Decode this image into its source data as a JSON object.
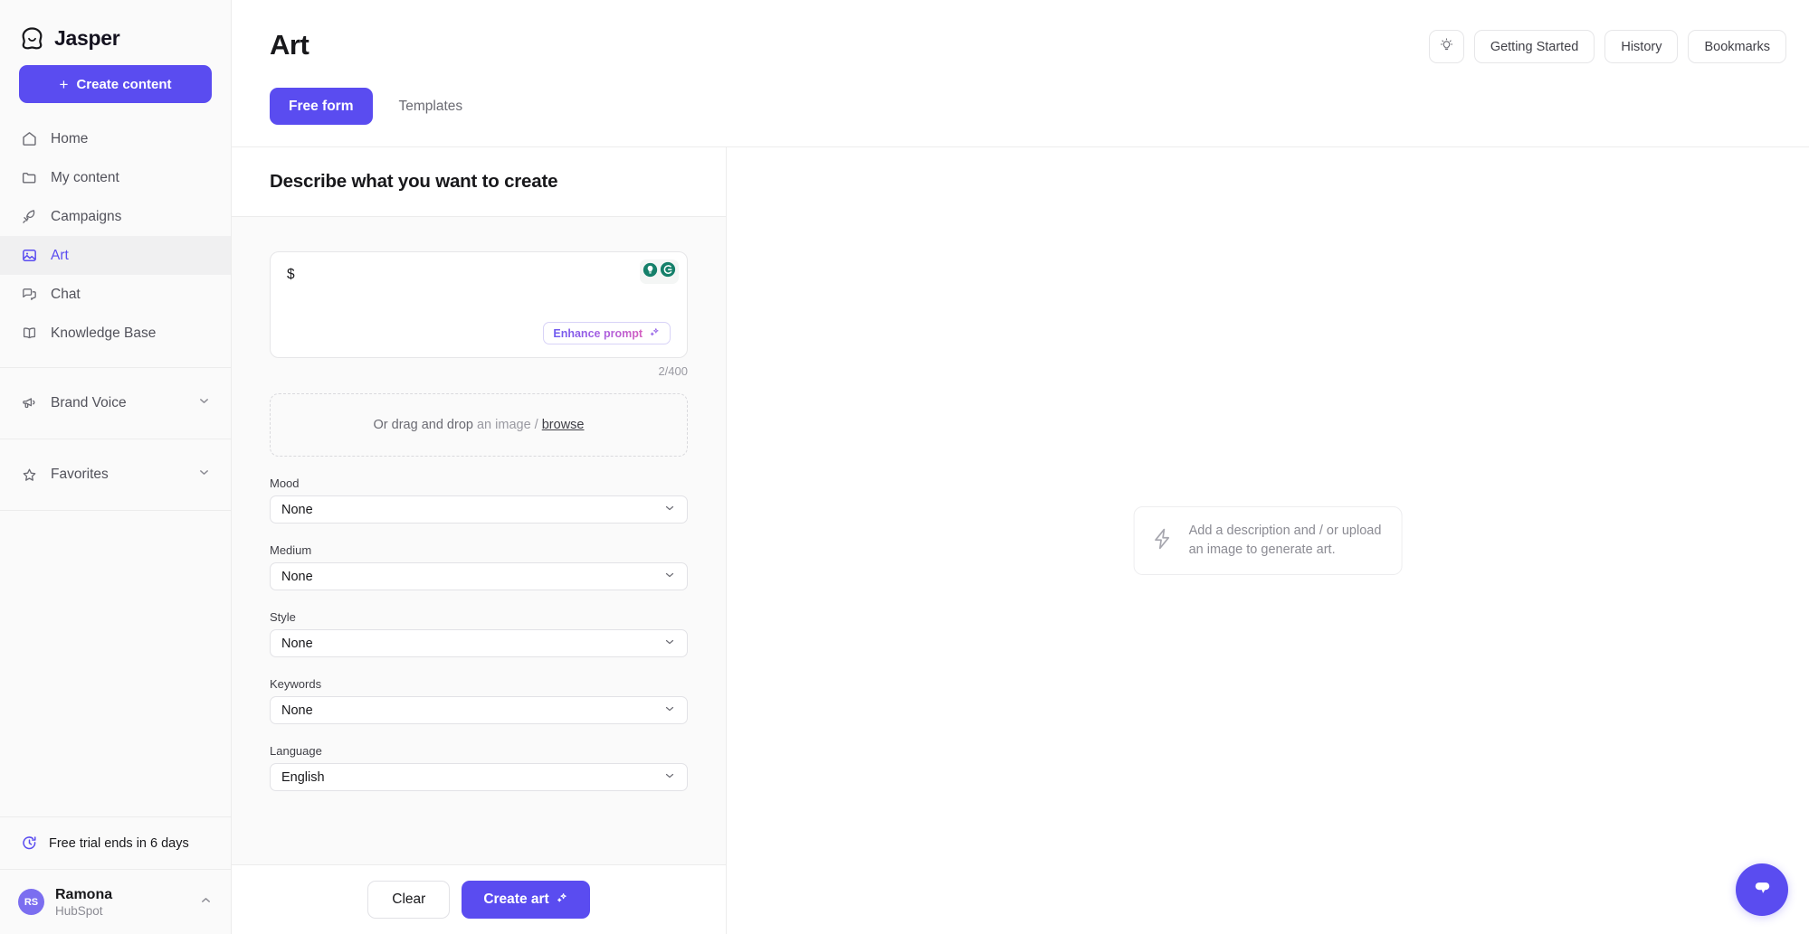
{
  "sidebar": {
    "brand": "Jasper",
    "create_button": "Create content",
    "nav_items": [
      {
        "label": "Home",
        "icon": "home-icon"
      },
      {
        "label": "My content",
        "icon": "folder-icon"
      },
      {
        "label": "Campaigns",
        "icon": "rocket-icon"
      },
      {
        "label": "Art",
        "icon": "image-icon"
      },
      {
        "label": "Chat",
        "icon": "chat-icon"
      },
      {
        "label": "Knowledge Base",
        "icon": "book-icon"
      }
    ],
    "active_nav": "Art",
    "sections": [
      {
        "label": "Brand Voice",
        "icon": "megaphone-icon"
      },
      {
        "label": "Favorites",
        "icon": "star-icon"
      }
    ],
    "trial_notice": "Free trial ends in 6 days",
    "user": {
      "initials": "RS",
      "name": "Ramona",
      "org": "HubSpot"
    }
  },
  "header": {
    "title": "Art",
    "tabs": [
      {
        "label": "Free form",
        "active": true
      },
      {
        "label": "Templates",
        "active": false
      }
    ],
    "actions": [
      {
        "label": "Getting Started"
      },
      {
        "label": "History"
      },
      {
        "label": "Bookmarks"
      }
    ],
    "tip_icon": "lightbulb-icon"
  },
  "panel": {
    "heading": "Describe what you want to create",
    "prompt_value": "$",
    "prompt_placeholder": "",
    "enhance_button": "Enhance prompt",
    "counter": "2/400",
    "dropzone": {
      "lead": "Or drag and drop",
      "rest": "an image /",
      "browse": "browse"
    },
    "fields": [
      {
        "label": "Mood",
        "value": "None"
      },
      {
        "label": "Medium",
        "value": "None"
      },
      {
        "label": "Style",
        "value": "None"
      },
      {
        "label": "Keywords",
        "value": "None"
      },
      {
        "label": "Language",
        "value": "English"
      }
    ],
    "clear_button": "Clear",
    "create_button": "Create art"
  },
  "canvas": {
    "empty_line1": "Add a description and / or upload",
    "empty_line2": "an image to generate art.",
    "empty_icon": "lightning-icon",
    "chat_fab_icon": "chat-bubble-icon"
  },
  "colors": {
    "accent": "#5a4cf0",
    "grammarly_green": "#15806a",
    "sidebar_bg": "#fafafa"
  }
}
